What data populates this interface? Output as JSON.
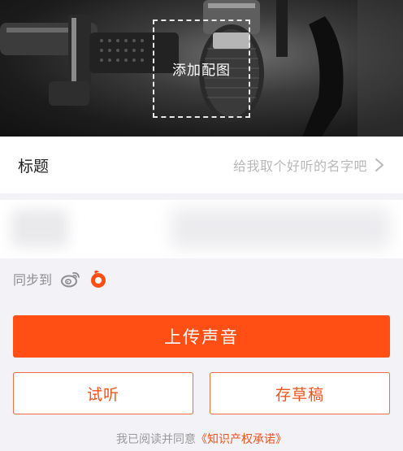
{
  "cover": {
    "add_cover_label": "添加配图"
  },
  "title_field": {
    "label": "标题",
    "placeholder": "给我取个好听的名字吧"
  },
  "sync": {
    "label": "同步到",
    "targets": [
      {
        "icon": "weibo-icon"
      },
      {
        "icon": "app-logo-icon"
      }
    ]
  },
  "actions": {
    "upload_label": "上传声音",
    "preview_label": "试听",
    "draft_label": "存草稿"
  },
  "agreement": {
    "prefix": "我已阅读并同意",
    "link": "《知识产权承诺》"
  },
  "colors": {
    "accent": "#ff4f14",
    "outline": "#f26a3d",
    "background": "#f2f2f7"
  }
}
